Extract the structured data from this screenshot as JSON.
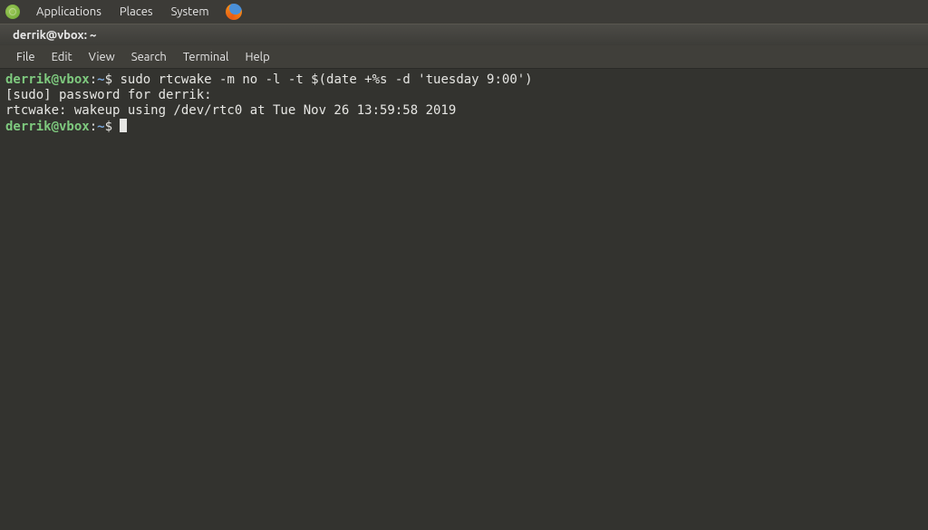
{
  "topPanel": {
    "menus": [
      "Applications",
      "Places",
      "System"
    ]
  },
  "window": {
    "title": "derrik@vbox: ~"
  },
  "menuBar": {
    "items": [
      "File",
      "Edit",
      "View",
      "Search",
      "Terminal",
      "Help"
    ]
  },
  "terminal": {
    "promptUser": "derrik@vbox",
    "promptColon": ":",
    "promptPath": "~",
    "promptSymbol": "$",
    "line1cmd": " sudo rtcwake -m no -l -t $(date +%s -d 'tuesday 9:00')",
    "line2": "[sudo] password for derrik:",
    "line3": "rtcwake: wakeup using /dev/rtc0 at Tue Nov 26 13:59:58 2019"
  }
}
